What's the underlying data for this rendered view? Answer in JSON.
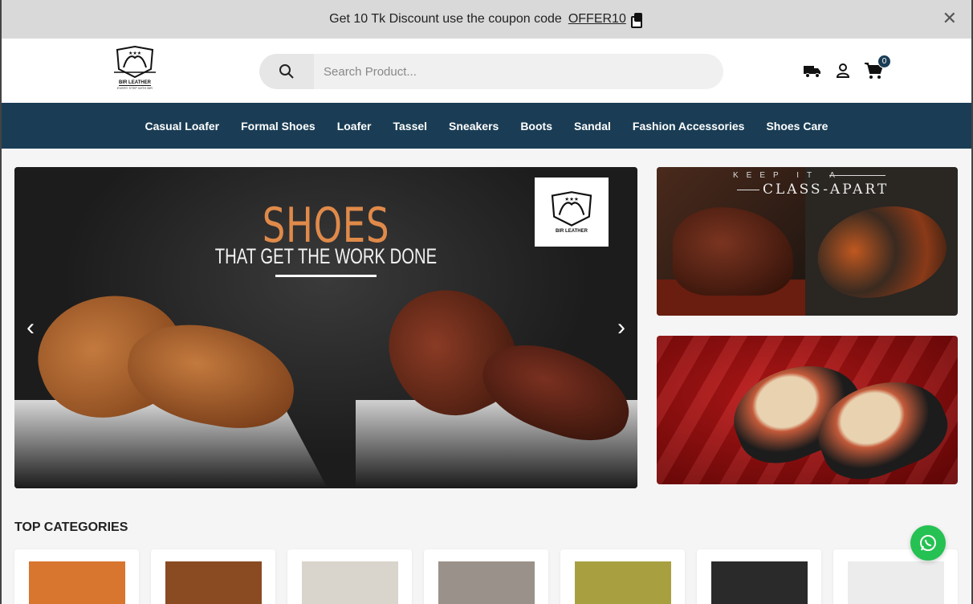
{
  "announcement": {
    "text": "Get 10 Tk Discount use the coupon code",
    "code": "OFFER10",
    "copy_icon": "copy-icon",
    "close_icon": "close-icon",
    "close_symbol": "✕"
  },
  "header": {
    "logo": {
      "name": "BIR LEATHER",
      "tagline": "EVERY STEP WITH BIR"
    },
    "search": {
      "placeholder": "Search Product...",
      "value": "",
      "icon": "search-icon"
    },
    "icons": [
      "truck-icon",
      "user-icon",
      "cart-icon"
    ],
    "cart_count": "0"
  },
  "nav": {
    "items": [
      {
        "label": "Casual Loafer"
      },
      {
        "label": "Formal Shoes"
      },
      {
        "label": "Loafer"
      },
      {
        "label": "Tassel"
      },
      {
        "label": "Sneakers"
      },
      {
        "label": "Boots"
      },
      {
        "label": "Sandal"
      },
      {
        "label": "Fashion Accessories"
      },
      {
        "label": "Shoes Care"
      }
    ]
  },
  "hero": {
    "title": "SHOES",
    "subtitle": "THAT GET THE WORK DONE",
    "badge_name": "BIR LEATHER",
    "prev_symbol": "‹",
    "next_symbol": "›"
  },
  "promo1": {
    "kicker": "KEEP IT A",
    "headline": "CLASS-APART"
  },
  "sections": {
    "top_categories": "TOP CATEGORIES"
  },
  "categories": [
    {
      "thumb_color": "#d8752e"
    },
    {
      "thumb_color": "#8a4a22"
    },
    {
      "thumb_color": "#d9d4cc"
    },
    {
      "thumb_color": "#9a928a"
    },
    {
      "thumb_color": "#a8a040"
    },
    {
      "thumb_color": "#2a2a2a"
    },
    {
      "thumb_color": "#ececec"
    }
  ],
  "colors": {
    "nav_bg": "#1a3d55",
    "announce_bg": "#d9d9d9",
    "whatsapp": "#25c152",
    "accent_title": "#e08a4a"
  },
  "floating": {
    "icon": "whatsapp-icon"
  }
}
